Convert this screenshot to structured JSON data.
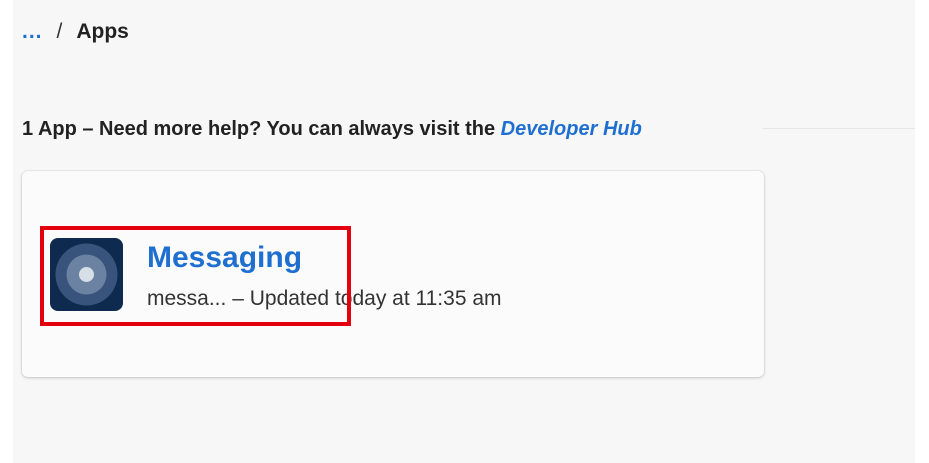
{
  "breadcrumb": {
    "ellipsis": "...",
    "separator": "/",
    "current": "Apps"
  },
  "summary": {
    "text": "1 App – Need more help? You can always visit the ",
    "link": "Developer Hub"
  },
  "app": {
    "name": "Messaging",
    "short_id": "messa...",
    "meta_separator": " – ",
    "updated": "Updated today at 11:35 am",
    "icon": "radio-dial-icon"
  },
  "colors": {
    "link": "#1f6fd1",
    "highlight": "#e3000f",
    "app_icon_bg": "#0f2a4f"
  }
}
